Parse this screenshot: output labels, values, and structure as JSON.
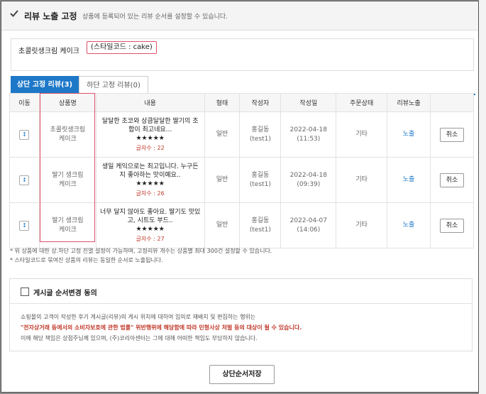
{
  "header": {
    "title": "리뷰 노출 고정",
    "description": "상품에 등록되어 있는 리뷰 순서를 설정할 수 있습니다."
  },
  "product": {
    "name": "초콜릿생크림 케이크",
    "style_code": "(스타일코드 : cake)"
  },
  "tabs": [
    {
      "label": "상단 고정 리뷰(3)",
      "active": true
    },
    {
      "label": "하단 고정 리뷰(0)",
      "active": false
    }
  ],
  "table": {
    "headers": [
      "이동",
      "상품명",
      "내용",
      "형태",
      "작성자",
      "작성일",
      "주문상태",
      "리뷰노출",
      ""
    ],
    "rows": [
      {
        "move_icon": "↕",
        "product": "초콜릿생크림\n케이크",
        "content": "달달한 초코와 상큼달달한 딸기의 조합이 최고네요...",
        "stars": "★★★★★",
        "count": "글자수 : 22",
        "type": "일반",
        "author": "홍길동\n(test1)",
        "date": "2022-04-18\n(11:53)",
        "status": "기타",
        "exposure": "노출",
        "action": "취소"
      },
      {
        "move_icon": "↕",
        "product": "딸기 생크림\n케이크",
        "content": "생일 케익으로는 최고입니다. 누구든지 좋아하는 맛이예요..",
        "stars": "★★★★★",
        "count": "글자수 : 26",
        "type": "일반",
        "author": "홍길동\n(test1)",
        "date": "2022-04-18\n(09:39)",
        "status": "기타",
        "exposure": "노출",
        "action": "취소"
      },
      {
        "move_icon": "↕",
        "product": "딸기 생크림\n케이크",
        "content": "너무 달지 않아도 좋아요. 딸기도 맛있고, 시트도 부드..",
        "stars": "★★★★★",
        "count": "글자수 : 27",
        "type": "일반",
        "author": "홍길동\n(test1)",
        "date": "2022-04-07\n(14:06)",
        "status": "기타",
        "exposure": "노출",
        "action": "취소"
      }
    ]
  },
  "notes": [
    "* 위 상품에 대한 상.하단 고정 진열 설정이 가능하며, 고정리뷰 개수는 상품별 최대 300건 설정할 수 있습니다.",
    "* 스타일코드로 묶여진 상품의 리뷰는 동일한 순서로 노출됩니다."
  ],
  "agreement": {
    "label": "게시글 순서변경 동의",
    "line1": "쇼핑몰의 고객이 작성한 후기 게시글(리뷰)의 게시 위치에 대하여 임의로 재배치 및 편집하는 행위는",
    "line2": "\"전자상거래 등에서의 소비자보호에 관한 법률\" 위반행위에 해당함에 따라 민형사상 처벌 등의 대상이 될 수 있습니다.",
    "line3": "이에 해당 책임은 상점주님께 있으며, (주)코리아센터는 그에 대해 어떠한 책임도 부담하지 않습니다."
  },
  "save_button": "상단순서저장",
  "colors": {
    "accent": "#1e78c8",
    "highlight": "#e0506a",
    "warning": "#c0392b"
  }
}
